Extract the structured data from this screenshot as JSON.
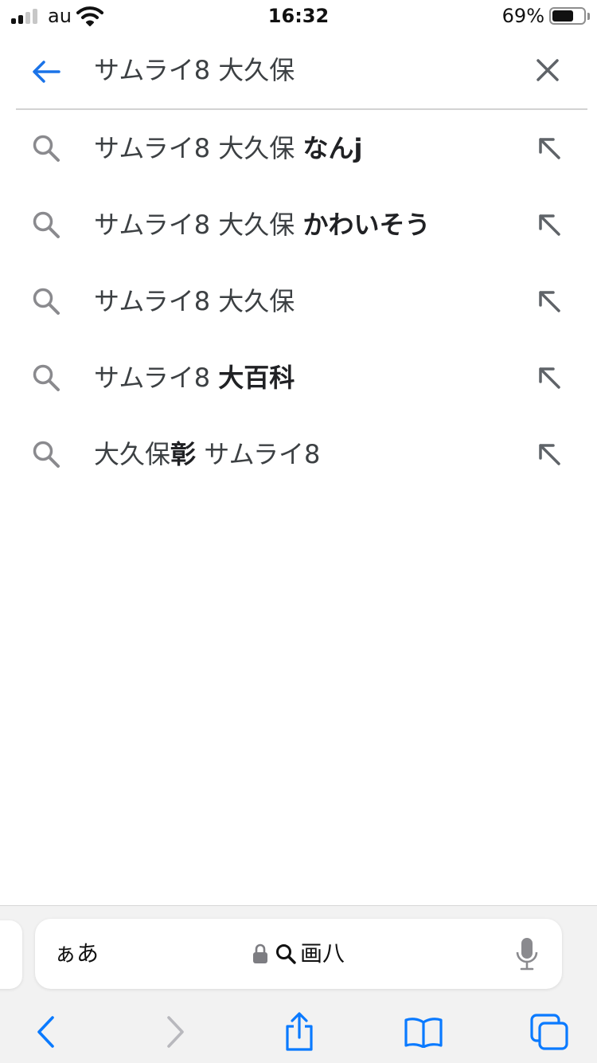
{
  "status_bar": {
    "carrier": "au",
    "time": "16:32",
    "battery_percent": "69%",
    "battery_level": 0.69,
    "signal_bars": 2,
    "icons": [
      "cellular-signal-icon",
      "wifi-icon",
      "battery-icon"
    ]
  },
  "search": {
    "query": "サムライ8 大久保",
    "back_icon": "arrow-left-icon",
    "clear_icon": "close-icon"
  },
  "suggestions": [
    {
      "base": "サムライ8 大久保 ",
      "bold": "なんj",
      "rest": ""
    },
    {
      "base": "サムライ8 大久保 ",
      "bold": "かわいそう",
      "rest": ""
    },
    {
      "base": "サムライ8 大久保",
      "bold": "",
      "rest": ""
    },
    {
      "base": "サムライ8 ",
      "bold": "大百科",
      "rest": ""
    },
    {
      "base": "大久保",
      "bold": "彰",
      "rest": " サムライ8"
    }
  ],
  "address_bar": {
    "format_button": "ぁあ",
    "url_text": "画八",
    "icons": [
      "lock-icon",
      "search-icon",
      "microphone-icon"
    ]
  },
  "toolbar": {
    "icons": [
      "back-icon",
      "forward-icon",
      "share-icon",
      "bookmarks-icon",
      "tabs-icon"
    ]
  },
  "colors": {
    "accent_blue": "#1a73e8",
    "safari_blue": "#0a7aff",
    "gray_icon": "#5f6368",
    "disabled_gray": "#b8b8bd"
  }
}
